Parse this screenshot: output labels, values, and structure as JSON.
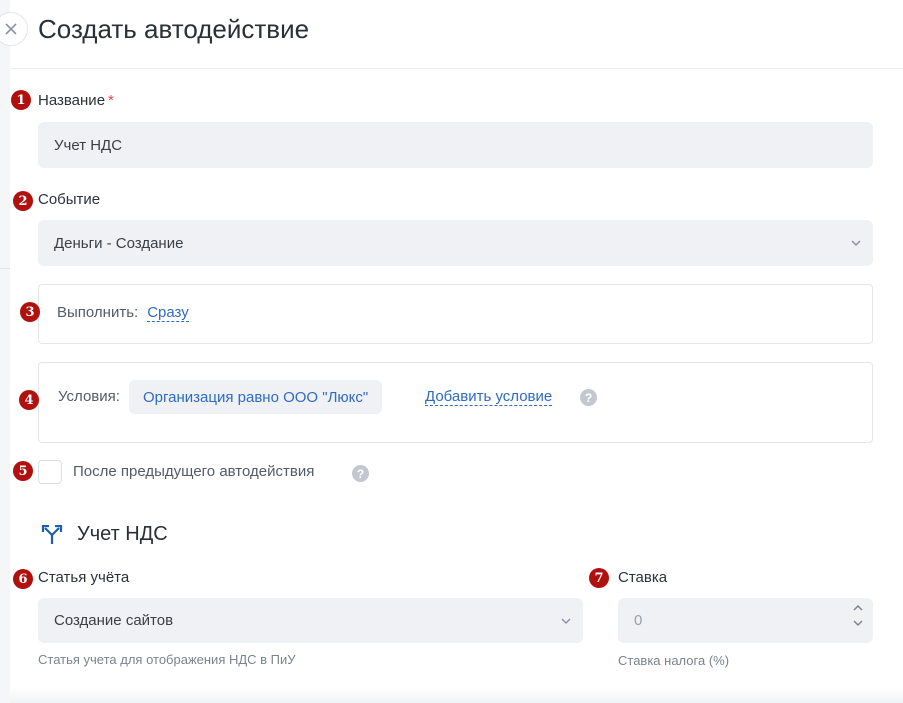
{
  "header": {
    "title": "Создать автодействие",
    "close_icon": "×"
  },
  "badges": [
    "1",
    "2",
    "3",
    "4",
    "5",
    "6",
    "7"
  ],
  "name_field": {
    "label": "Название",
    "required_mark": "*",
    "value": "Учет НДС"
  },
  "event_field": {
    "label": "Событие",
    "value": "Деньги - Создание"
  },
  "execute": {
    "label": "Выполнить:",
    "value": "Сразу"
  },
  "conditions": {
    "label": "Условия:",
    "chip": "Организация равно ООО \"Люкс\"",
    "add_link": "Добавить условие",
    "help": "?"
  },
  "after_previous": {
    "label": "После предыдущего автодействия",
    "checked": false,
    "help": "?"
  },
  "section": {
    "title": "Учет НДС",
    "icon": "fork-arrows-icon"
  },
  "account_item": {
    "label": "Статья учёта",
    "value": "Создание сайтов",
    "hint": "Статья учета для отображения НДС в ПиУ"
  },
  "rate": {
    "label": "Ставка",
    "placeholder": "0",
    "hint": "Ставка налога (%)"
  },
  "colors": {
    "badge": "#b1110e",
    "link": "#2f6bc2",
    "required": "#e5484d",
    "input_bg": "#f0f1f5"
  }
}
